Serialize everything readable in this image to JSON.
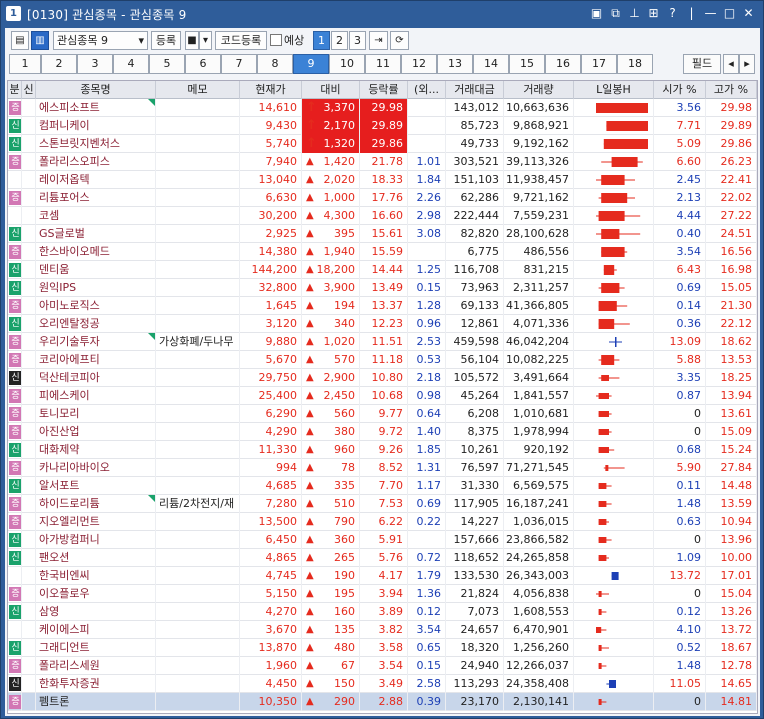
{
  "window": {
    "icon": "1",
    "title": "[0130] 관심종목 - 관심종목 9",
    "controls": [
      "window-list-icon",
      "restore-icon",
      "pin-icon",
      "grid-icon",
      "help-icon",
      "minimize-icon",
      "maximize-icon",
      "close-icon"
    ]
  },
  "toolbar": {
    "group_select": "관심종목 9",
    "register_label": "등록",
    "code_register_label": "코드등록",
    "forecast_label": "예상",
    "page_buttons": [
      "1",
      "2",
      "3"
    ],
    "active_page": "1"
  },
  "tabs": {
    "items": [
      "1",
      "2",
      "3",
      "4",
      "5",
      "6",
      "7",
      "8",
      "9",
      "10",
      "11",
      "12",
      "13",
      "14",
      "15",
      "16",
      "17",
      "18"
    ],
    "active": "9",
    "field_label": "필드"
  },
  "columns": [
    "분",
    "신",
    "종목명",
    "메모",
    "현재가",
    "대비",
    "등락률",
    "(외...",
    "거래대금",
    "거래량",
    "L일봉H",
    "시가 %",
    "고가 %"
  ],
  "badge_colors": {
    "증": "#d277b4",
    "신": "#1aa26b",
    "신_dark": "#222222"
  },
  "colors": {
    "up": "#e52b1e",
    "down": "#1c3fb5",
    "highlight": "#e61e1e",
    "selected_row": "#c8d6ea"
  },
  "rows": [
    {
      "badge": "증",
      "name": "에스피소프트",
      "memo": "",
      "flag": true,
      "price": "14,610",
      "arrow": "limit",
      "change": "3,370",
      "rate": "29.98",
      "foreign": "",
      "amount": "143,012",
      "volume": "10,663,636",
      "candle": {
        "o": 0.0,
        "c": 1.0,
        "l": 0.0,
        "h": 1.0,
        "color": "red",
        "big": true
      },
      "open": "3.56",
      "high": "29.98",
      "hl": true
    },
    {
      "badge": "신",
      "name": "컴퍼니케이",
      "memo": "",
      "flag": false,
      "price": "9,430",
      "arrow": "limit",
      "change": "2,170",
      "rate": "29.89",
      "foreign": "",
      "amount": "85,723",
      "volume": "9,868,921",
      "candle": {
        "o": 0.2,
        "c": 1.0,
        "l": 0.2,
        "h": 1.0,
        "color": "red",
        "big": true
      },
      "open": "7.71",
      "high": "29.89",
      "hl": true
    },
    {
      "badge": "신",
      "name": "스톤브릿지벤처스",
      "memo": "",
      "flag": false,
      "price": "5,740",
      "arrow": "limit",
      "change": "1,320",
      "rate": "29.86",
      "foreign": "",
      "amount": "49,733",
      "volume": "9,192,162",
      "candle": {
        "o": 0.15,
        "c": 1.0,
        "l": 0.15,
        "h": 1.0,
        "color": "red",
        "big": true
      },
      "open": "5.09",
      "high": "29.86",
      "hl": true
    },
    {
      "badge": "증",
      "name": "폴라리스오피스",
      "memo": "",
      "flag": false,
      "price": "7,940",
      "arrow": "up",
      "change": "1,420",
      "rate": "21.78",
      "foreign": "1.01",
      "amount": "303,521",
      "volume": "39,113,326",
      "candle": {
        "o": 0.3,
        "c": 0.8,
        "l": 0.1,
        "h": 0.9,
        "color": "red",
        "big": true
      },
      "open": "6.60",
      "high": "26.23",
      "hl": false
    },
    {
      "badge": "",
      "name": "레이저옵텍",
      "memo": "",
      "flag": false,
      "price": "13,040",
      "arrow": "up",
      "change": "2,020",
      "rate": "18.33",
      "foreign": "1.84",
      "amount": "151,103",
      "volume": "11,938,457",
      "candle": {
        "o": 0.1,
        "c": 0.55,
        "l": 0.0,
        "h": 0.75,
        "color": "red",
        "big": true
      },
      "open": "2.45",
      "high": "22.41",
      "hl": false
    },
    {
      "badge": "증",
      "name": "리튬포어스",
      "memo": "",
      "flag": false,
      "price": "6,630",
      "arrow": "up",
      "change": "1,000",
      "rate": "17.76",
      "foreign": "2.26",
      "amount": "62,286",
      "volume": "9,721,162",
      "candle": {
        "o": 0.1,
        "c": 0.6,
        "l": 0.05,
        "h": 0.75,
        "color": "red",
        "big": true
      },
      "open": "2.13",
      "high": "22.02",
      "hl": false
    },
    {
      "badge": "",
      "name": "코셈",
      "memo": "",
      "flag": false,
      "price": "30,200",
      "arrow": "up",
      "change": "4,300",
      "rate": "16.60",
      "foreign": "2.98",
      "amount": "222,444",
      "volume": "7,559,231",
      "candle": {
        "o": 0.05,
        "c": 0.55,
        "l": 0.0,
        "h": 0.85,
        "color": "red",
        "big": true
      },
      "open": "4.44",
      "high": "27.22",
      "hl": false
    },
    {
      "badge": "신",
      "name": "GS글로벌",
      "memo": "",
      "flag": false,
      "price": "2,925",
      "arrow": "up",
      "change": "395",
      "rate": "15.61",
      "foreign": "3.08",
      "amount": "82,820",
      "volume": "28,100,628",
      "candle": {
        "o": 0.1,
        "c": 0.45,
        "l": 0.0,
        "h": 0.85,
        "color": "red",
        "big": true
      },
      "open": "0.40",
      "high": "24.51",
      "hl": false
    },
    {
      "badge": "증",
      "name": "한스바이오메드",
      "memo": "",
      "flag": false,
      "price": "14,380",
      "arrow": "up",
      "change": "1,940",
      "rate": "15.59",
      "foreign": "",
      "amount": "6,775",
      "volume": "486,556",
      "candle": {
        "o": 0.1,
        "c": 0.55,
        "l": 0.1,
        "h": 0.6,
        "color": "red",
        "big": true
      },
      "open": "3.54",
      "high": "16.56",
      "hl": false
    },
    {
      "badge": "신",
      "name": "덴티움",
      "memo": "",
      "flag": false,
      "price": "144,200",
      "arrow": "up",
      "change": "18,200",
      "rate": "14.44",
      "foreign": "1.25",
      "amount": "116,708",
      "volume": "831,215",
      "candle": {
        "o": 0.15,
        "c": 0.35,
        "l": 0.15,
        "h": 0.4,
        "color": "red",
        "big": true
      },
      "open": "6.43",
      "high": "16.98",
      "hl": false
    },
    {
      "badge": "신",
      "name": "원익IPS",
      "memo": "",
      "flag": false,
      "price": "32,800",
      "arrow": "up",
      "change": "3,900",
      "rate": "13.49",
      "foreign": "0.15",
      "amount": "73,963",
      "volume": "2,311,257",
      "candle": {
        "o": 0.1,
        "c": 0.45,
        "l": 0.05,
        "h": 0.55,
        "color": "red",
        "big": true
      },
      "open": "0.69",
      "high": "15.05",
      "hl": false
    },
    {
      "badge": "증",
      "name": "아미노로직스",
      "memo": "",
      "flag": false,
      "price": "1,645",
      "arrow": "up",
      "change": "194",
      "rate": "13.37",
      "foreign": "1.28",
      "amount": "69,133",
      "volume": "41,366,805",
      "candle": {
        "o": 0.05,
        "c": 0.4,
        "l": 0.05,
        "h": 0.6,
        "color": "red",
        "big": true
      },
      "open": "0.14",
      "high": "21.30",
      "hl": false
    },
    {
      "badge": "신",
      "name": "오리엔탈정공",
      "memo": "",
      "flag": false,
      "price": "3,120",
      "arrow": "up",
      "change": "340",
      "rate": "12.23",
      "foreign": "0.96",
      "amount": "12,861",
      "volume": "4,071,336",
      "candle": {
        "o": 0.05,
        "c": 0.35,
        "l": 0.05,
        "h": 0.65,
        "color": "red",
        "big": true
      },
      "open": "0.36",
      "high": "22.12",
      "hl": false
    },
    {
      "badge": "증",
      "name": "우리기술투자",
      "memo": "가상화폐/두나무",
      "flag": true,
      "price": "9,880",
      "arrow": "up",
      "change": "1,020",
      "rate": "11.51",
      "foreign": "2.53",
      "amount": "459,598",
      "volume": "46,042,204",
      "candle": {
        "o": 0.38,
        "c": 0.38,
        "l": 0.25,
        "h": 0.5,
        "color": "blue",
        "big": false,
        "cross": true
      },
      "open": "13.09",
      "high": "18.62",
      "hl": false
    },
    {
      "badge": "증",
      "name": "코리아에프티",
      "memo": "",
      "flag": false,
      "price": "5,670",
      "arrow": "up",
      "change": "570",
      "rate": "11.18",
      "foreign": "0.53",
      "amount": "56,104",
      "volume": "10,082,225",
      "candle": {
        "o": 0.1,
        "c": 0.35,
        "l": 0.05,
        "h": 0.45,
        "color": "red",
        "big": true
      },
      "open": "5.88",
      "high": "13.53",
      "hl": false
    },
    {
      "badge": "신_dark",
      "name": "덕산테코피아",
      "memo": "",
      "flag": false,
      "price": "29,750",
      "arrow": "up",
      "change": "2,900",
      "rate": "10.80",
      "foreign": "2.18",
      "amount": "105,572",
      "volume": "3,491,664",
      "candle": {
        "o": 0.1,
        "c": 0.25,
        "l": 0.05,
        "h": 0.45,
        "color": "red",
        "big": false
      },
      "open": "3.35",
      "high": "18.25",
      "hl": false
    },
    {
      "badge": "증",
      "name": "피에스케이",
      "memo": "",
      "flag": false,
      "price": "25,400",
      "arrow": "up",
      "change": "2,450",
      "rate": "10.68",
      "foreign": "0.98",
      "amount": "45,264",
      "volume": "1,841,557",
      "candle": {
        "o": 0.05,
        "c": 0.25,
        "l": 0.0,
        "h": 0.3,
        "color": "red",
        "big": false
      },
      "open": "0.87",
      "high": "13.94",
      "hl": false
    },
    {
      "badge": "증",
      "name": "토니모리",
      "memo": "",
      "flag": false,
      "price": "6,290",
      "arrow": "up",
      "change": "560",
      "rate": "9.77",
      "foreign": "0.64",
      "amount": "6,208",
      "volume": "1,010,681",
      "candle": {
        "o": 0.05,
        "c": 0.25,
        "l": 0.05,
        "h": 0.3,
        "color": "red",
        "big": false
      },
      "open": "0",
      "high": "13.61",
      "hl": false
    },
    {
      "badge": "증",
      "name": "아진산업",
      "memo": "",
      "flag": false,
      "price": "4,290",
      "arrow": "up",
      "change": "380",
      "rate": "9.72",
      "foreign": "1.40",
      "amount": "8,375",
      "volume": "1,978,994",
      "candle": {
        "o": 0.05,
        "c": 0.25,
        "l": 0.05,
        "h": 0.3,
        "color": "red",
        "big": false
      },
      "open": "0",
      "high": "15.09",
      "hl": false
    },
    {
      "badge": "신",
      "name": "대화제약",
      "memo": "",
      "flag": false,
      "price": "11,330",
      "arrow": "up",
      "change": "960",
      "rate": "9.26",
      "foreign": "1.85",
      "amount": "10,261",
      "volume": "920,192",
      "candle": {
        "o": 0.05,
        "c": 0.25,
        "l": 0.05,
        "h": 0.35,
        "color": "red",
        "big": false
      },
      "open": "0.68",
      "high": "15.24",
      "hl": false
    },
    {
      "badge": "증",
      "name": "카나리아바이오",
      "memo": "",
      "flag": false,
      "price": "994",
      "arrow": "up",
      "change": "78",
      "rate": "8.52",
      "foreign": "1.31",
      "amount": "76,597",
      "volume": "71,271,545",
      "candle": {
        "o": 0.18,
        "c": 0.22,
        "l": 0.15,
        "h": 0.55,
        "color": "red",
        "big": false
      },
      "open": "5.90",
      "high": "27.84",
      "hl": false
    },
    {
      "badge": "신",
      "name": "알서포트",
      "memo": "",
      "flag": false,
      "price": "4,685",
      "arrow": "up",
      "change": "335",
      "rate": "7.70",
      "foreign": "1.17",
      "amount": "31,330",
      "volume": "6,569,575",
      "candle": {
        "o": 0.05,
        "c": 0.2,
        "l": 0.05,
        "h": 0.3,
        "color": "red",
        "big": false
      },
      "open": "0.11",
      "high": "14.48",
      "hl": false
    },
    {
      "badge": "증",
      "name": "하이드로리튬",
      "memo": "리튬/2차전지/재",
      "flag": true,
      "price": "7,280",
      "arrow": "up",
      "change": "510",
      "rate": "7.53",
      "foreign": "0.69",
      "amount": "117,905",
      "volume": "16,187,241",
      "candle": {
        "o": 0.05,
        "c": 0.2,
        "l": 0.05,
        "h": 0.3,
        "color": "red",
        "big": false
      },
      "open": "1.48",
      "high": "13.59",
      "hl": false
    },
    {
      "badge": "증",
      "name": "지오엘리먼트",
      "memo": "",
      "flag": false,
      "price": "13,500",
      "arrow": "up",
      "change": "790",
      "rate": "6.22",
      "foreign": "0.22",
      "amount": "14,227",
      "volume": "1,036,015",
      "candle": {
        "o": 0.05,
        "c": 0.2,
        "l": 0.05,
        "h": 0.25,
        "color": "red",
        "big": false
      },
      "open": "0.63",
      "high": "10.94",
      "hl": false
    },
    {
      "badge": "신",
      "name": "아가방컴퍼니",
      "memo": "",
      "flag": false,
      "price": "6,450",
      "arrow": "up",
      "change": "360",
      "rate": "5.91",
      "foreign": "",
      "amount": "157,666",
      "volume": "23,866,582",
      "candle": {
        "o": 0.05,
        "c": 0.2,
        "l": 0.05,
        "h": 0.3,
        "color": "red",
        "big": false
      },
      "open": "0",
      "high": "13.96",
      "hl": false
    },
    {
      "badge": "신",
      "name": "팬오션",
      "memo": "",
      "flag": false,
      "price": "4,865",
      "arrow": "up",
      "change": "265",
      "rate": "5.76",
      "foreign": "0.72",
      "amount": "118,652",
      "volume": "24,265,858",
      "candle": {
        "o": 0.05,
        "c": 0.2,
        "l": 0.05,
        "h": 0.25,
        "color": "red",
        "big": false
      },
      "open": "1.09",
      "high": "10.00",
      "hl": false
    },
    {
      "badge": "",
      "name": "한국비엔씨",
      "memo": "",
      "flag": false,
      "price": "4,745",
      "arrow": "up",
      "change": "190",
      "rate": "4.17",
      "foreign": "1.79",
      "amount": "133,530",
      "volume": "26,343,003",
      "candle": {
        "o": 0.3,
        "c": 0.3,
        "l": 0.3,
        "h": 0.35,
        "color": "blue",
        "big": false,
        "box": true
      },
      "open": "13.72",
      "high": "17.01",
      "hl": false
    },
    {
      "badge": "증",
      "name": "이오플로우",
      "memo": "",
      "flag": false,
      "price": "5,150",
      "arrow": "up",
      "change": "195",
      "rate": "3.94",
      "foreign": "1.36",
      "amount": "21,824",
      "volume": "4,056,838",
      "candle": {
        "o": 0.05,
        "c": 0.1,
        "l": 0.0,
        "h": 0.25,
        "color": "red",
        "big": false
      },
      "open": "0",
      "high": "15.04",
      "hl": false
    },
    {
      "badge": "신",
      "name": "삼영",
      "memo": "",
      "flag": false,
      "price": "4,270",
      "arrow": "up",
      "change": "160",
      "rate": "3.89",
      "foreign": "0.12",
      "amount": "7,073",
      "volume": "1,608,553",
      "candle": {
        "o": 0.05,
        "c": 0.1,
        "l": 0.05,
        "h": 0.2,
        "color": "red",
        "big": false
      },
      "open": "0.12",
      "high": "13.26",
      "hl": false
    },
    {
      "badge": "",
      "name": "케이에스피",
      "memo": "",
      "flag": false,
      "price": "3,670",
      "arrow": "up",
      "change": "135",
      "rate": "3.82",
      "foreign": "3.54",
      "amount": "24,657",
      "volume": "6,470,901",
      "candle": {
        "o": 0.0,
        "c": 0.1,
        "l": 0.0,
        "h": 0.2,
        "color": "red",
        "big": false
      },
      "open": "4.10",
      "high": "13.72",
      "hl": false
    },
    {
      "badge": "신",
      "name": "그래디언트",
      "memo": "",
      "flag": false,
      "price": "13,870",
      "arrow": "up",
      "change": "480",
      "rate": "3.58",
      "foreign": "0.65",
      "amount": "18,320",
      "volume": "1,256,260",
      "candle": {
        "o": 0.05,
        "c": 0.1,
        "l": 0.05,
        "h": 0.25,
        "color": "red",
        "big": false
      },
      "open": "0.52",
      "high": "18.67",
      "hl": false
    },
    {
      "badge": "증",
      "name": "폴라리스세원",
      "memo": "",
      "flag": false,
      "price": "1,960",
      "arrow": "up",
      "change": "67",
      "rate": "3.54",
      "foreign": "0.15",
      "amount": "24,940",
      "volume": "12,266,037",
      "candle": {
        "o": 0.05,
        "c": 0.1,
        "l": 0.05,
        "h": 0.2,
        "color": "red",
        "big": false
      },
      "open": "1.48",
      "high": "12.78",
      "hl": false
    },
    {
      "badge": "신_dark",
      "name": "한화투자증권",
      "memo": "",
      "flag": false,
      "price": "4,450",
      "arrow": "up",
      "change": "150",
      "rate": "3.49",
      "foreign": "2.58",
      "amount": "113,293",
      "volume": "24,358,408",
      "candle": {
        "o": 0.25,
        "c": 0.25,
        "l": 0.2,
        "h": 0.3,
        "color": "blue",
        "big": false,
        "box": true
      },
      "open": "11.05",
      "high": "14.65",
      "hl": false
    },
    {
      "badge": "증",
      "name": "펨트론",
      "memo": "",
      "flag": false,
      "price": "10,350",
      "arrow": "up",
      "change": "290",
      "rate": "2.88",
      "foreign": "0.39",
      "amount": "23,170",
      "volume": "2,130,141",
      "candle": {
        "o": 0.05,
        "c": 0.1,
        "l": 0.05,
        "h": 0.2,
        "color": "red",
        "big": false
      },
      "open": "0",
      "high": "14.81",
      "hl": false,
      "selected": true
    }
  ]
}
